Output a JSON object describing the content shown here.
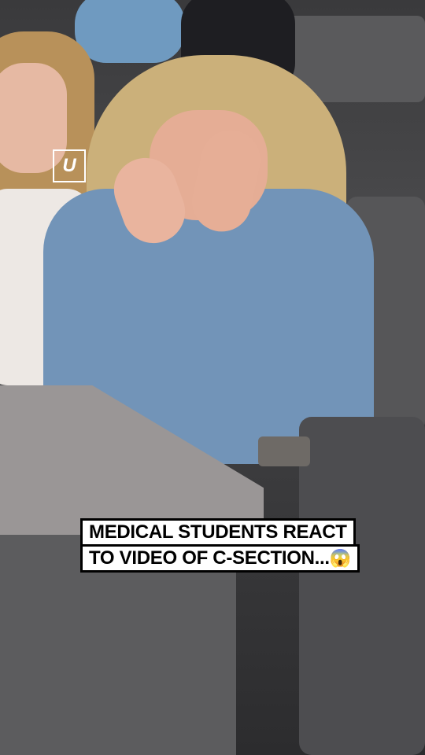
{
  "logo": {
    "text": "U"
  },
  "caption": {
    "line1": "MEDICAL STUDENTS REACT",
    "line2": "TO VIDEO OF C-SECTION...",
    "emoji": "😱"
  }
}
